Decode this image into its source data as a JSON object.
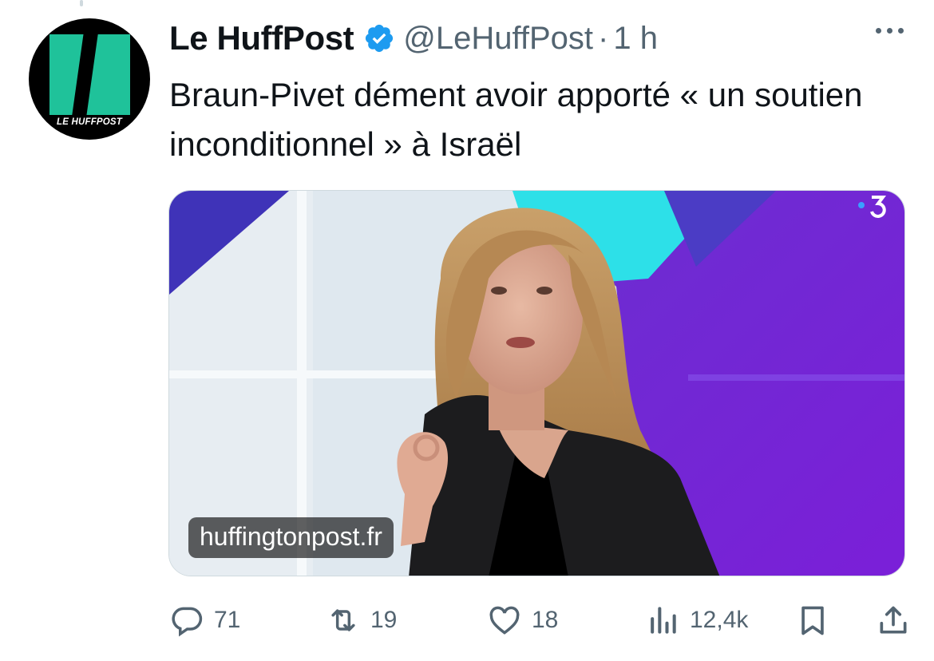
{
  "author": {
    "display_name": "Le HuffPost",
    "handle": "@LeHuffPost",
    "separator": "·",
    "time": "1 h",
    "avatar_wordmark": "LE HUFFPOST",
    "verified": true
  },
  "tweet": {
    "text": "Braun-Pivet dément avoir apporté « un soutien inconditionnel » à Israël"
  },
  "media": {
    "domain_label": "huffingtonpost.fr",
    "icons": [
      "channel-logo"
    ]
  },
  "actions": {
    "replies": "71",
    "retweets": "19",
    "likes": "18",
    "views": "12,4k"
  },
  "colors": {
    "brand_green": "#1fc29a",
    "verified_blue": "#1d9bf0",
    "secondary_text": "#536471"
  },
  "icons": [
    "more-icon",
    "reply-icon",
    "retweet-icon",
    "like-icon",
    "views-icon",
    "bookmark-icon",
    "share-icon",
    "verified-icon"
  ]
}
